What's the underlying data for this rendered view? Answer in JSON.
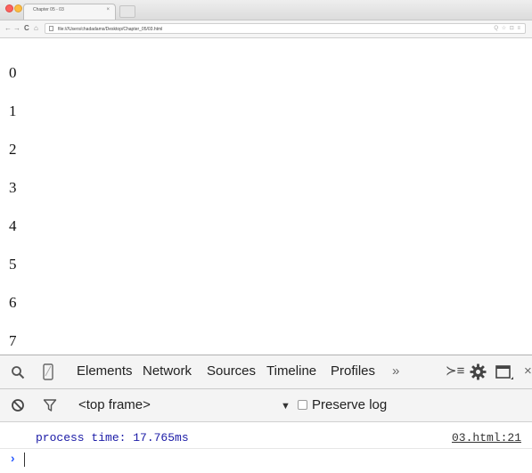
{
  "browser": {
    "tab_title": "Chapter 05 - 03",
    "tab_close": "×",
    "url": "file:///Users/chadadams/Desktop/Chapter_05/03.html",
    "nav": {
      "back": "←",
      "forward": "→",
      "reload": "C",
      "home": "⌂"
    },
    "right_icons": "Q ☆ ⊡ ≡"
  },
  "page": {
    "lines": [
      "0",
      "1",
      "2",
      "3",
      "4",
      "5",
      "6",
      "7"
    ]
  },
  "devtools": {
    "tabs": [
      "Elements",
      "Network",
      "Sources",
      "Timeline",
      "Profiles"
    ],
    "more": "»",
    "drawer_icon": "≻≡",
    "frame_select": "<top frame>",
    "frame_arrow": "▼",
    "preserve_log_label": "Preserve log",
    "preserve_log_checked": false
  },
  "console": {
    "messages": [
      {
        "text": "process time: 17.765ms",
        "source": "03.html:21"
      }
    ],
    "prompt": "›"
  },
  "colors": {
    "console_message": "#1a1aa6",
    "prompt": "#2a5aff"
  }
}
